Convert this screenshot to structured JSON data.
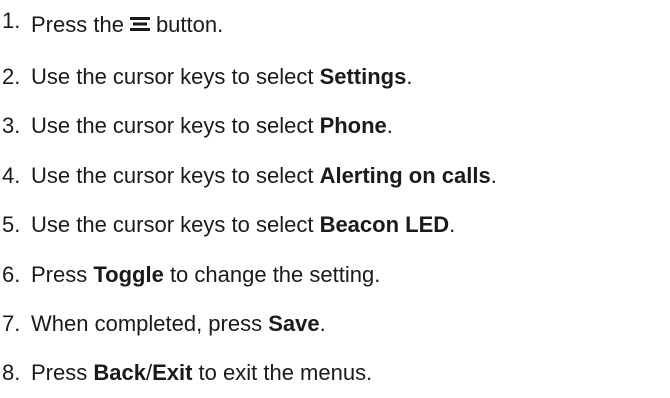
{
  "steps": [
    {
      "num": "1.",
      "before": "Press the",
      "after": "button.",
      "icon": "menu-icon"
    },
    {
      "num": "2.",
      "before": "Use the cursor keys to select ",
      "bold": "Settings",
      "after": "."
    },
    {
      "num": "3.",
      "before": "Use the cursor keys to select ",
      "bold": "Phone",
      "after": "."
    },
    {
      "num": "4.",
      "before": "Use the cursor keys to select ",
      "bold": "Alerting on calls",
      "after": "."
    },
    {
      "num": "5.",
      "before": "Use the cursor keys to select ",
      "bold": "Beacon LED",
      "after": "."
    },
    {
      "num": "6.",
      "before": "Press ",
      "bold": "Toggle",
      "after": " to change the setting."
    },
    {
      "num": "7.",
      "before": "When completed, press ",
      "bold": "Save",
      "after": "."
    },
    {
      "num": "8.",
      "before": "Press ",
      "bold": "Back",
      "mid": "/",
      "bold2": "Exit",
      "after": " to exit the menus."
    }
  ]
}
